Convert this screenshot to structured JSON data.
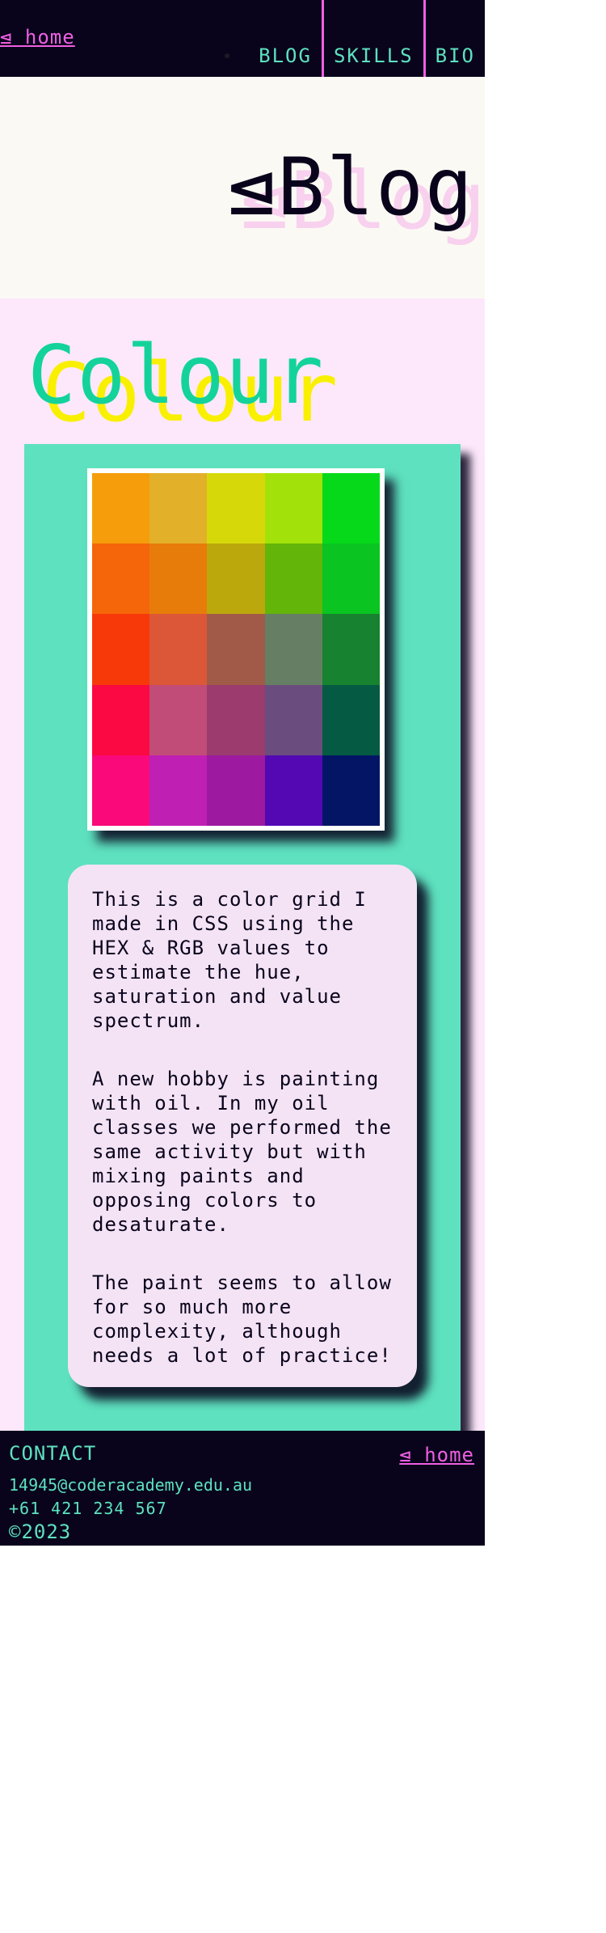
{
  "header": {
    "home_link": "⊴ home",
    "nav": [
      {
        "label": "BLOG"
      },
      {
        "label": "SKILLS"
      },
      {
        "label": "BIO"
      }
    ]
  },
  "page": {
    "title": "⊴Blog",
    "title_shadow": "⊴Blog"
  },
  "section": {
    "heading": "Colour",
    "heading_shadow": "Colour"
  },
  "colour_grid": {
    "swatches": [
      "#f59d0a",
      "#e3b02a",
      "#d7d80a",
      "#a2e20a",
      "#05d91a",
      "#f5650a",
      "#e87c0b",
      "#bba80c",
      "#63b50a",
      "#09c421",
      "#f7390a",
      "#dc5737",
      "#a15a48",
      "#667e64",
      "#17822f",
      "#fb0943",
      "#c14c78",
      "#9b3b6e",
      "#6b4c7e",
      "#045a42",
      "#f9097a",
      "#c01fb3",
      "#9d1aa0",
      "#5308b4",
      "#051566"
    ]
  },
  "description": {
    "paragraphs": [
      "This is a color grid I made in CSS using the HEX & RGB values to estimate the hue, saturation and value spectrum.",
      "A new hobby is painting with oil. In my oil classes we performed the same activity but with mixing paints and opposing colors to desaturate.",
      "The paint seems to allow for so much more complexity, although needs a lot of practice!"
    ]
  },
  "footer": {
    "contact_title": "CONTACT",
    "email": "14945@coderacademy.edu.au",
    "phone": "+61 421 234 567",
    "copyright": "©2023",
    "home_link": "⊴ home"
  }
}
